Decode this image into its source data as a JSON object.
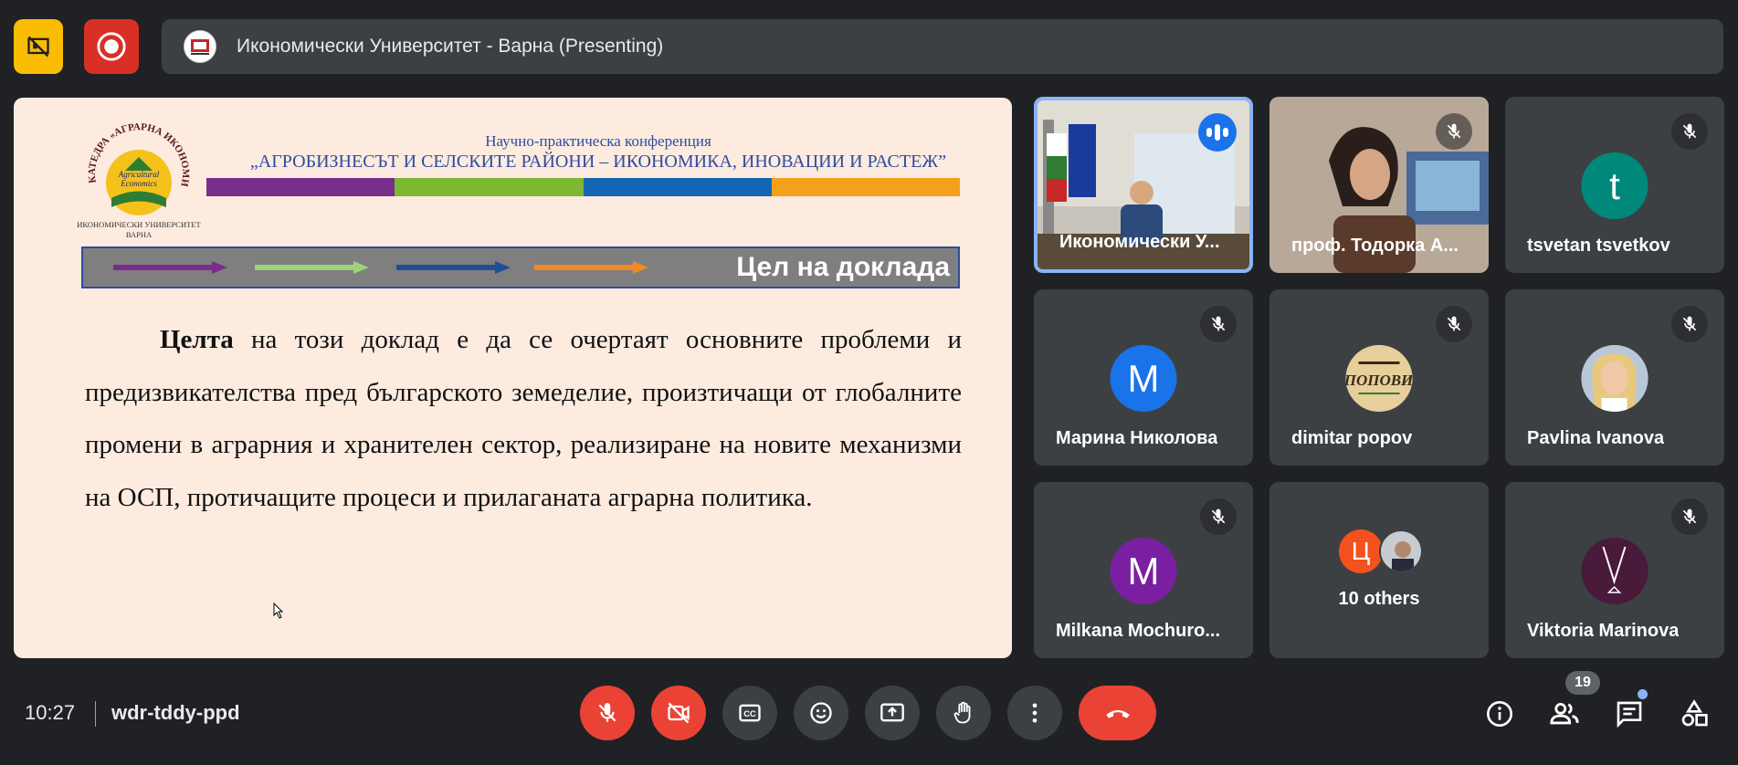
{
  "topbar": {
    "presenting_title": "Икономически Университет - Варна (Presenting)"
  },
  "slide": {
    "logo_top_text": "КАТЕДРА «АГРАРНА ИКОНОМИКА»",
    "logo_mid_text": "Agricultural Economics",
    "logo_bottom_line1": "ИКОНОМИЧЕСКИ УНИВЕРСИТЕТ",
    "logo_bottom_line2": "ВАРНА",
    "conf_line1": "Научно-практическа конференция",
    "conf_line2": "„АГРОБИЗНЕСЪТ И СЕЛСКИТЕ РАЙОНИ – ИКОНОМИКА, ИНОВАЦИИ И РАСТЕЖ”",
    "goal_title": "Цел на доклада",
    "body_bold": "Целта",
    "body_text": " на този доклад е да се очертаят основните проблеми и предизвикателства пред българското земеделие, произтичащи от глобалните промени в аграрния и хранителен сектор, реализиране на новите механизми на ОСП, протичащите процеси и прилаганата аграрна политика.",
    "colors": [
      "#7a2e8c",
      "#7cb832",
      "#1466b2",
      "#f5a01a"
    ]
  },
  "participants": [
    {
      "name": "Икономически У...",
      "type": "video",
      "speaking": true
    },
    {
      "name": "проф. Тодорка А...",
      "type": "video",
      "muted": true
    },
    {
      "name": "tsvetan tsvetkov",
      "initial": "t",
      "color": "#00897b",
      "muted": true
    },
    {
      "name": "Марина Николова",
      "initial": "М",
      "color": "#1a73e8",
      "muted": true
    },
    {
      "name": "dimitar popov",
      "type": "image",
      "image_text": "ПОПОВИ",
      "muted": true
    },
    {
      "name": "Pavlina Ivanova",
      "type": "photo",
      "muted": true
    },
    {
      "name": "Milkana Mochuro...",
      "initial": "M",
      "color": "#7b1fa2",
      "muted": true
    },
    {
      "name": "10 others",
      "type": "others",
      "initial": "Ц",
      "color": "#f4511e"
    },
    {
      "name": "Viktoria Marinova",
      "type": "image",
      "color": "#4a1a3a",
      "muted": true
    }
  ],
  "bottombar": {
    "time": "10:27",
    "meeting_code": "wdr-tddy-ppd",
    "people_count": "19"
  }
}
